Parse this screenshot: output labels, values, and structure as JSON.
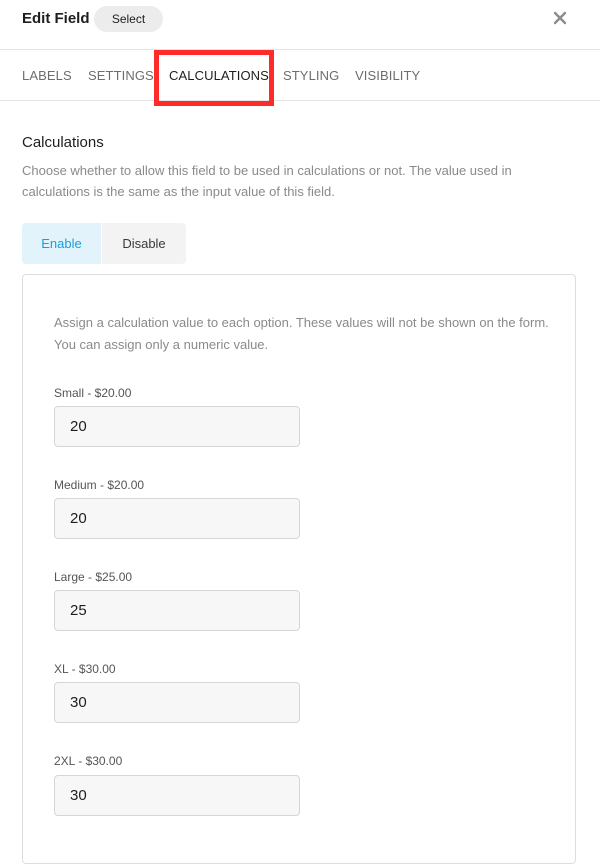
{
  "header": {
    "title": "Edit Field",
    "select_label": "Select",
    "close_icon": "close-icon"
  },
  "tabs": [
    {
      "label": "LABELS",
      "active": false
    },
    {
      "label": "SETTINGS",
      "active": false
    },
    {
      "label": "CALCULATIONS",
      "active": true
    },
    {
      "label": "STYLING",
      "active": false
    },
    {
      "label": "VISIBILITY",
      "active": false
    }
  ],
  "highlight_color": "#ff2a2a",
  "section": {
    "title": "Calculations",
    "description": "Choose whether to allow this field to be used in calculations or not. The value used in calculations is the same as the input value of this field."
  },
  "toggle": {
    "enable_label": "Enable",
    "disable_label": "Disable",
    "selected": "Enable",
    "accent_color": "#1a9fd9"
  },
  "panel": {
    "description": "Assign a calculation value to each option. These values will not be shown on the form. You can assign only a numeric value.",
    "options": [
      {
        "label": "Small - $20.00",
        "value": "20"
      },
      {
        "label": "Medium - $20.00",
        "value": "20"
      },
      {
        "label": "Large - $25.00",
        "value": "25"
      },
      {
        "label": "XL - $30.00",
        "value": "30"
      },
      {
        "label": "2XL - $30.00",
        "value": "30"
      }
    ]
  }
}
